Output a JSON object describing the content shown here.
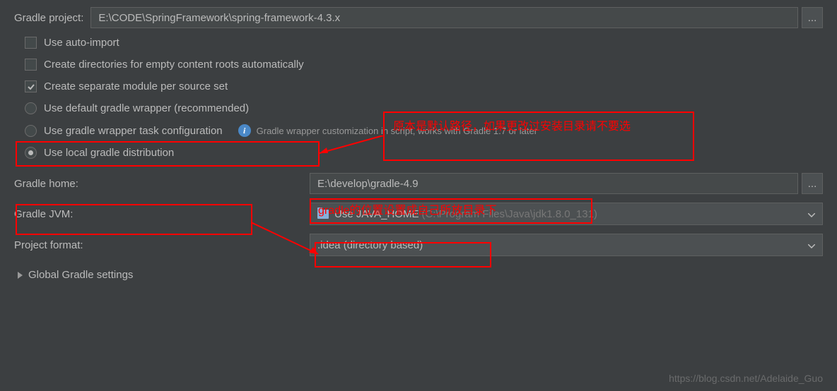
{
  "projectRow": {
    "label": "Gradle project:",
    "value": "E:\\CODE\\SpringFramework\\spring-framework-4.3.x"
  },
  "checkboxes": {
    "autoImport": {
      "label": "Use auto-import",
      "checked": false
    },
    "createDirs": {
      "label": "Create directories for empty content roots automatically",
      "checked": false
    },
    "separateModule": {
      "label": "Create separate module per source set",
      "checked": true
    }
  },
  "radios": {
    "defaultWrapper": {
      "label": "Use default gradle wrapper (recommended)",
      "selected": false
    },
    "wrapperTask": {
      "label": "Use gradle wrapper task configuration",
      "selected": false
    },
    "localDist": {
      "label": "Use local gradle distribution",
      "selected": true
    }
  },
  "infoText": "Gradle wrapper customization in script, works with Gradle 1.7 or later",
  "gradleHome": {
    "label": "Gradle home:",
    "value": "E:\\develop\\gradle-4.9"
  },
  "gradleJvm": {
    "label": "Gradle JVM:",
    "value": "Use JAVA_HOME",
    "hint": "(C:\\Program Files\\Java\\jdk1.8.0_131)"
  },
  "projectFormat": {
    "label": "Project format:",
    "value": ".idea (directory based)"
  },
  "globalSettings": "Global Gradle settings",
  "annotations": {
    "box1": "原本是默认路径，如果更改过安装目录请不要选",
    "box2": "gradle的位置设置成自己所放目录下"
  },
  "watermark": "https://blog.csdn.net/Adelaide_Guo"
}
